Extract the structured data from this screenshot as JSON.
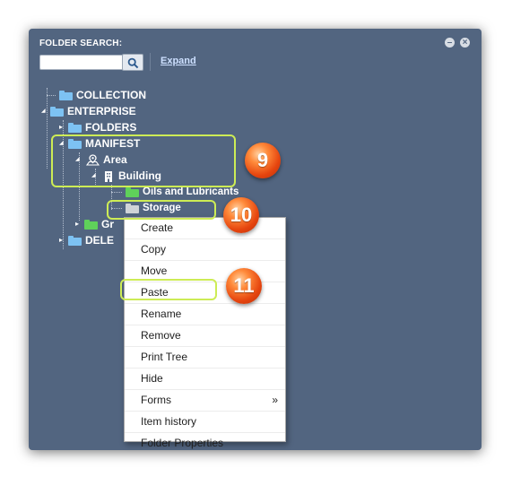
{
  "panel": {
    "title": "FOLDER SEARCH:",
    "minimize_glyph": "–",
    "close_glyph": "×",
    "search_placeholder": "",
    "expand_label": "Expand"
  },
  "tree": {
    "collection": "COLLECTION",
    "enterprise": "ENTERPRISE",
    "folders": "FOLDERS",
    "manifest": "MANIFEST",
    "area": "Area",
    "building": "Building",
    "oils": "Oils and Lubricants",
    "storage": "Storage",
    "gr_partial": "Gr",
    "dele_partial": "DELE"
  },
  "toggles": {
    "collapsed": "▸",
    "expanded": "◢"
  },
  "icons": {
    "search": "search-icon",
    "folder": "folder-icon",
    "area": "map-pin-icon",
    "building": "building-icon"
  },
  "colors": {
    "panel_bg": "#526580",
    "folder_blue": "#7dc2f3",
    "folder_green": "#5fd15a",
    "folder_grey": "#cfd3d7",
    "callout": "#cdec55",
    "badge": "#e5440e"
  },
  "callouts": [
    "9",
    "10",
    "11"
  ],
  "context_menu": {
    "items": [
      "Create",
      "Copy",
      "Move",
      "Paste",
      "Rename",
      "Remove",
      "Print Tree",
      "Hide",
      "Forms",
      "Item history",
      "Folder Properties"
    ],
    "submenu_arrow": "»"
  }
}
